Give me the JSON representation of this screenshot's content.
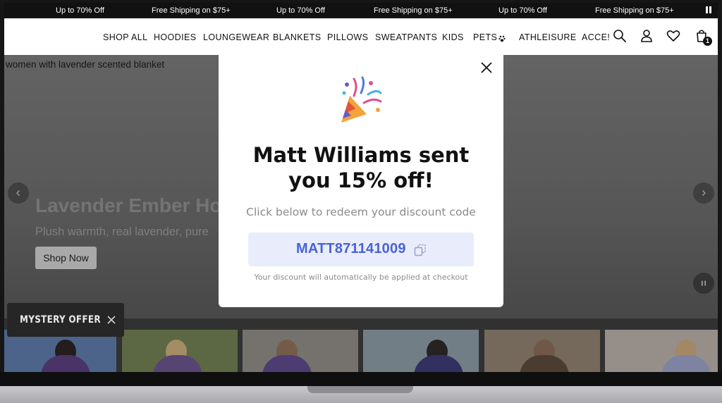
{
  "announcement": {
    "messages": [
      "Up to 70% Off",
      "Free Shipping on $75+",
      "Up to 70% Off",
      "Free Shipping on $75+",
      "Up to 70% Off",
      "Free Shipping on $75+"
    ],
    "pause_icon": "pause-icon"
  },
  "nav": {
    "items": [
      "SHOP ALL",
      "HOODIES",
      "LOUNGEWEAR",
      "BLANKETS",
      "PILLOWS",
      "SWEATPANTS",
      "KIDS",
      "PETS",
      "ATHLEISURE",
      "ACCE!"
    ],
    "icons": [
      "search-icon",
      "account-icon",
      "wishlist-heart-icon",
      "cart-icon"
    ],
    "cart_count": "1"
  },
  "hero": {
    "image_alt": "women with lavender scented blanket",
    "title": "Lavender Ember Ho",
    "subtitle": "Plush warmth, real lavender, pure",
    "cta": "Shop Now"
  },
  "mystery_offer": {
    "label": "MYSTERY OFFER"
  },
  "modal": {
    "title_line1": "Matt Williams sent",
    "title_line2": "you 15% off!",
    "subtitle": "Click below to redeem your discount code",
    "code": "MATT871141009",
    "note": "Your discount will automatically be applied at checkout",
    "icon": "party-popper-icon"
  },
  "colors": {
    "accent_code": "#4a62d6",
    "code_box_bg": "#e9ecfa",
    "announcement_bg": "#111111"
  }
}
